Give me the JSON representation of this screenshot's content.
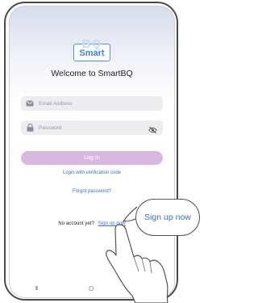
{
  "app": {
    "logo_text": "Smart",
    "logo_back_text": "BQ",
    "welcome_title": "Welcome to SmartBQ"
  },
  "form": {
    "email_placeholder": "Email Address",
    "password_placeholder": "Password",
    "login_label": "Log In",
    "verification_link": "Login with verification code",
    "forgot_link": "Forgot password?"
  },
  "footer": {
    "no_account_text": "No account yet?",
    "signup_link": "Sign up now"
  },
  "callout": {
    "text": "Sign up now"
  },
  "nav": {
    "recents_glyph": "III",
    "home_glyph": "O",
    "back_glyph": "<"
  },
  "colors": {
    "accent": "#3a6fd8",
    "button": "#d9b8df",
    "field_bg": "#ececf1"
  },
  "icons": [
    "mail-icon",
    "lock-icon",
    "eye-slash-icon",
    "hand-pointer-icon"
  ]
}
